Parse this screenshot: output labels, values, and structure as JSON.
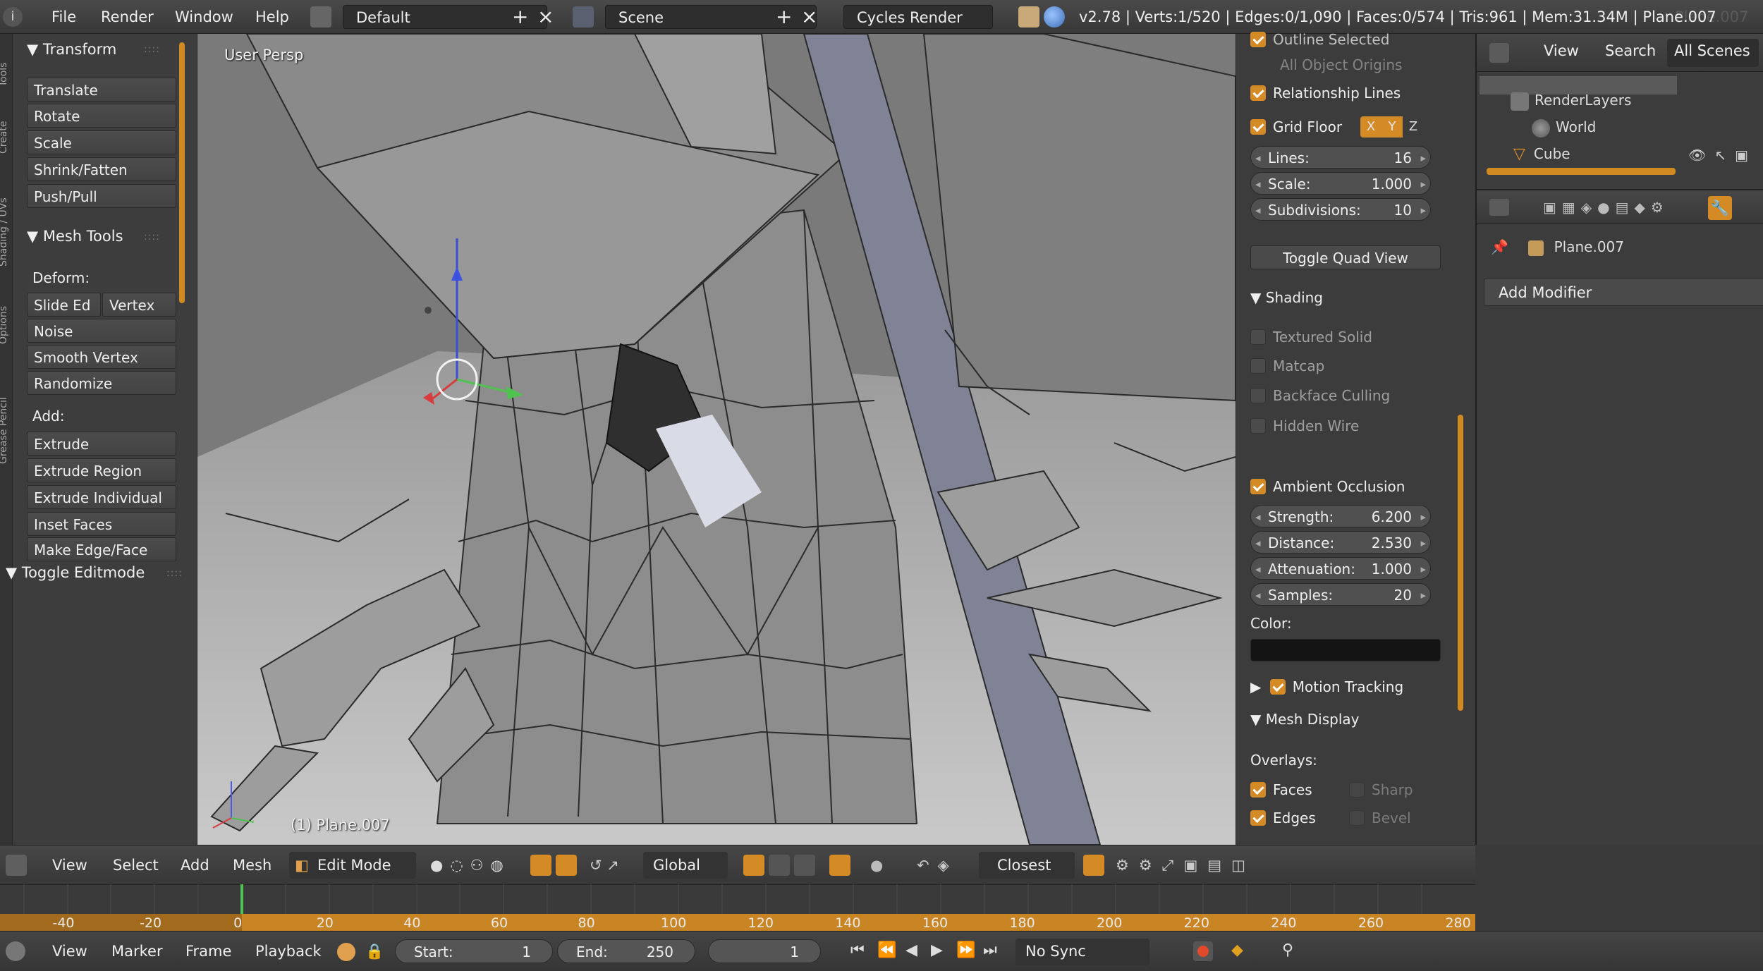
{
  "topbar": {
    "menus": [
      "File",
      "Render",
      "Window",
      "Help"
    ],
    "layout": "Default",
    "scene": "Scene",
    "engine": "Cycles Render",
    "stats": "v2.78 | Verts:1/520 | Edges:0/1,090 | Faces:0/574 | Tris:961 | Mem:31.34M | Plane.007",
    "stats_ghost": "Plane.007"
  },
  "toolshelf": {
    "tabs": [
      "Tools",
      "Create",
      "Shading / UVs",
      "Options",
      "Grease Pencil"
    ],
    "transform_header": "Transform",
    "transform_buttons": [
      "Translate",
      "Rotate",
      "Scale",
      "Shrink/Fatten",
      "Push/Pull"
    ],
    "mesh_tools_header": "Mesh Tools",
    "deform_label": "Deform:",
    "slide_edge": "Slide Ed",
    "vertex": "Vertex",
    "deform_buttons": [
      "Noise",
      "Smooth Vertex",
      "Randomize"
    ],
    "add_label": "Add:",
    "add_buttons": [
      "Extrude",
      "Extrude Region",
      "Extrude Individual",
      "Inset Faces",
      "Make Edge/Face"
    ],
    "toggle_editmode": "Toggle Editmode"
  },
  "viewport": {
    "view_label": "User Persp",
    "object_label": "(1) Plane.007"
  },
  "npanel": {
    "outline_selected": "Outline Selected",
    "all_object_origins": "All Object Origins",
    "relationship_lines": "Relationship Lines",
    "grid_floor": "Grid Floor",
    "axes": [
      "X",
      "Y",
      "Z"
    ],
    "lines_label": "Lines:",
    "lines_value": "16",
    "scale_label": "Scale:",
    "scale_value": "1.000",
    "subdivisions_label": "Subdivisions:",
    "subdivisions_value": "10",
    "toggle_quad_view": "Toggle Quad View",
    "shading_header": "Shading",
    "textured_solid": "Textured Solid",
    "matcap": "Matcap",
    "backface_culling": "Backface Culling",
    "hidden_wire": "Hidden Wire",
    "ambient_occlusion": "Ambient Occlusion",
    "strength_label": "Strength:",
    "strength_value": "6.200",
    "distance_label": "Distance:",
    "distance_value": "2.530",
    "attenuation_label": "Attenuation:",
    "attenuation_value": "1.000",
    "samples_label": "Samples:",
    "samples_value": "20",
    "color_label": "Color:",
    "motion_tracking": "Motion Tracking",
    "mesh_display_header": "Mesh Display",
    "overlays_label": "Overlays:",
    "faces": "Faces",
    "edges": "Edges",
    "sharp": "Sharp",
    "bevel": "Bevel"
  },
  "outliner": {
    "menu": [
      "View",
      "Search",
      "All Scenes"
    ],
    "items": [
      "RenderLayers",
      "World",
      "Cube"
    ]
  },
  "properties": {
    "object_name": "Plane.007",
    "add_modifier": "Add Modifier"
  },
  "vpheader": {
    "menus": [
      "View",
      "Select",
      "Add",
      "Mesh"
    ],
    "mode": "Edit Mode",
    "orientation": "Global",
    "snap": "Closest"
  },
  "timeline": {
    "ticks": [
      "-40",
      "-20",
      "0",
      "20",
      "40",
      "60",
      "80",
      "100",
      "120",
      "140",
      "160",
      "180",
      "200",
      "220",
      "240",
      "260",
      "280"
    ],
    "current_frame_marker": "0"
  },
  "footer": {
    "menus": [
      "View",
      "Marker",
      "Frame",
      "Playback"
    ],
    "start_label": "Start:",
    "start_value": "1",
    "end_label": "End:",
    "end_value": "250",
    "current_frame": "1",
    "sync": "No Sync"
  },
  "colors": {
    "accent_orange": "#d58b25",
    "panel_bg": "#3c3c3c",
    "header_bg": "#404040",
    "viewport_bg": "#6e6e6e"
  }
}
